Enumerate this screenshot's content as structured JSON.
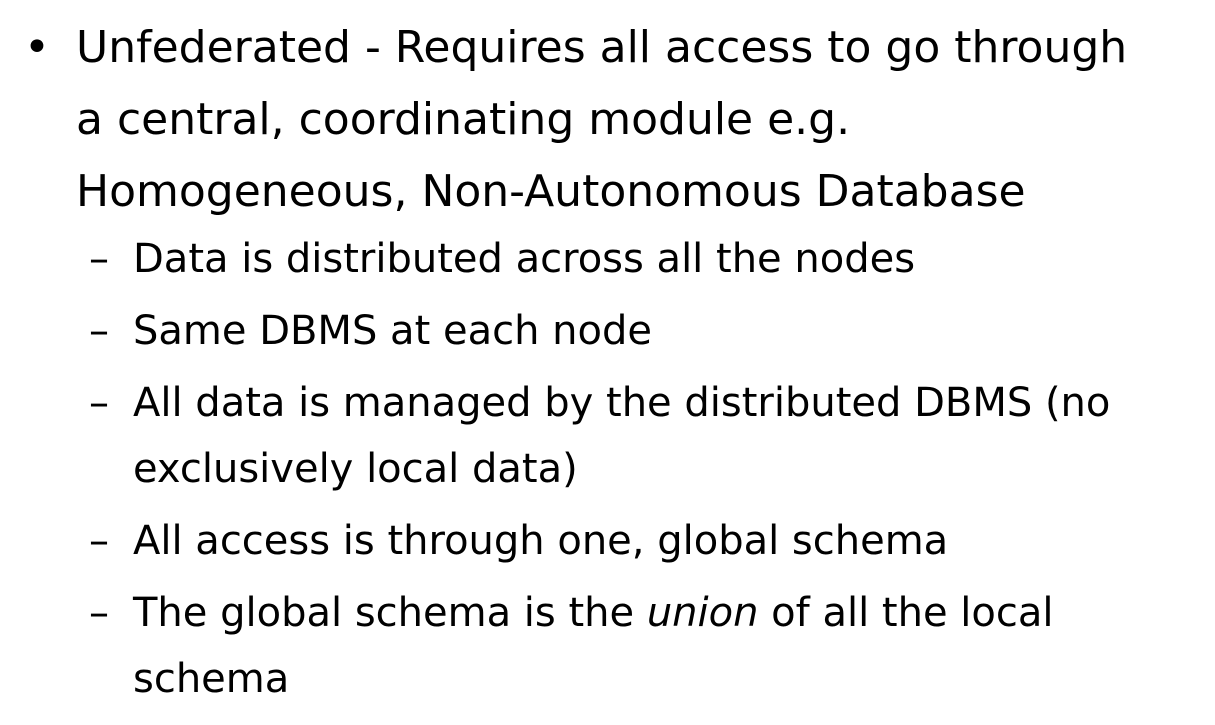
{
  "bullet_symbol": "•",
  "dash_symbol": "–",
  "main_bullet": {
    "line1": "Unfederated - Requires all access to go through",
    "line2": "a central, coordinating module e.g.",
    "line3": "Homogeneous, Non-Autonomous Database"
  },
  "sub_bullets": {
    "item1": "Data is distributed across all the nodes",
    "item2": "Same DBMS at each node",
    "item3_line1": "All data is managed by the distributed DBMS (no",
    "item3_line2": "exclusively local data)",
    "item4": "All access is through one, global schema",
    "item5_before": "The global schema is the ",
    "item5_em": "union",
    "item5_after": " of all the local",
    "item5_line2": "schema"
  }
}
